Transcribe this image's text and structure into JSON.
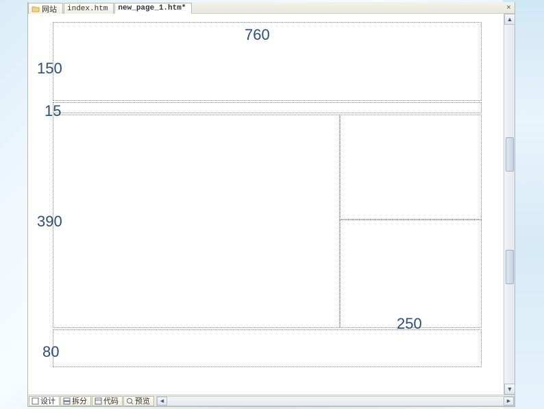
{
  "tabs": {
    "site": {
      "label": "网站"
    },
    "index": {
      "label": "index.htm"
    },
    "newpage": {
      "label": "new_page_1.htm*"
    }
  },
  "close_x": "×",
  "layout": {
    "width_label": "760",
    "header_h": "150",
    "spacer_h": "15",
    "main_h": "390",
    "right_w": "250",
    "footer_h": "80"
  },
  "viewbar": {
    "design": "设计",
    "split": "拆分",
    "code": "代码",
    "preview": "预览"
  },
  "scroll": {
    "up": "▲",
    "down": "▼",
    "left": "◄",
    "right": "►"
  }
}
